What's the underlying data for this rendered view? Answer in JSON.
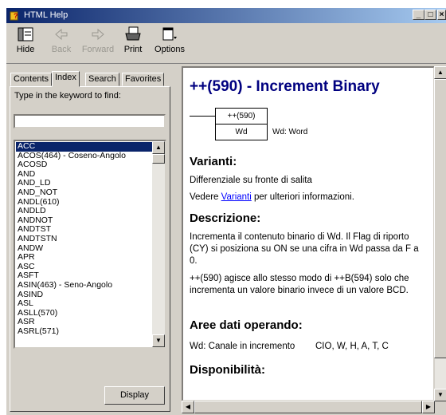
{
  "window": {
    "title": "HTML Help"
  },
  "toolbar": {
    "hide": "Hide",
    "back": "Back",
    "forward": "Forward",
    "print": "Print",
    "options": "Options"
  },
  "tabs": {
    "contents": "Contents",
    "index": "Index",
    "search": "Search",
    "favorites": "Favorites"
  },
  "index": {
    "keyword_label": "Type in the keyword to find:",
    "keyword_value": "",
    "items": [
      "ACC",
      "ACOS(464) - Coseno-Angolo",
      "ACOSD",
      "AND",
      "AND_LD",
      "AND_NOT",
      "ANDL(610)",
      "ANDLD",
      "ANDNOT",
      "ANDTST",
      "ANDTSTN",
      "ANDW",
      "APR",
      "ASC",
      "ASFT",
      "ASIN(463) - Seno-Angolo",
      "ASIND",
      "ASL",
      "ASLL(570)",
      "ASR",
      "ASRL(571)"
    ],
    "selected": "ACC",
    "display_button": "Display"
  },
  "topic": {
    "title": "++(590) - Increment Binary",
    "diagram": {
      "box_top": "++(590)",
      "box_bottom": "Wd",
      "operand_note": "Wd: Word"
    },
    "varianti_heading": "Varianti:",
    "varianti_line1": "Differenziale su fronte di salita",
    "varianti_pre": "Vedere ",
    "varianti_link": "Varianti",
    "varianti_post": " per ulteriori informazioni.",
    "descrizione_heading": "Descrizione:",
    "descrizione_p1": "Incrementa il contenuto binario di Wd. Il Flag di riporto (CY) si posiziona su ON se una cifra in Wd passa da F a 0.",
    "descrizione_p2": "++(590) agisce allo stesso modo di ++B(594) solo che incrementa un valore binario invece di un valore BCD.",
    "aree_heading": "Aree dati operando:",
    "aree_label": "Wd:  Canale in incremento",
    "aree_value": "CIO, W, H, A, T, C",
    "disponibilita_heading": "Disponibilità:"
  }
}
